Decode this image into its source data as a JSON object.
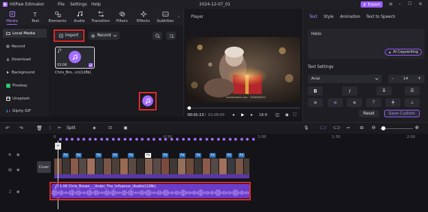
{
  "app": {
    "name": "HitPaw Edimakor",
    "title": "2024-12-07_01",
    "export_label": "Export"
  },
  "menu": [
    "File",
    "Settings",
    "Help"
  ],
  "tabs": [
    {
      "label": "Media",
      "icon": "media-icon"
    },
    {
      "label": "Text",
      "icon": "text-icon"
    },
    {
      "label": "Elements",
      "icon": "elements-icon"
    },
    {
      "label": "Audio",
      "icon": "audio-icon"
    },
    {
      "label": "Transition",
      "icon": "transition-icon"
    },
    {
      "label": "Filters",
      "icon": "filters-icon"
    },
    {
      "label": "Effects",
      "icon": "effects-icon"
    },
    {
      "label": "Subtitles",
      "icon": "subtitles-icon"
    }
  ],
  "leftnav": [
    {
      "label": "Local Media",
      "icon": "folder-icon"
    },
    {
      "label": "Record",
      "icon": "record-icon"
    },
    {
      "label": "Download",
      "icon": "download-icon"
    },
    {
      "label": "Background",
      "icon": "background-icon"
    },
    {
      "label": "Pixabay",
      "icon": "pixabay-icon"
    },
    {
      "label": "Unsplash",
      "icon": "unsplash-icon"
    },
    {
      "label": "Giphy GIF",
      "icon": "giphy-icon"
    }
  ],
  "media": {
    "import_label": "Import",
    "record_label": "Record",
    "item": {
      "duration": "03:06",
      "name": "Chris_Bro...ic)(128k)"
    }
  },
  "player": {
    "title": "Player",
    "watermark": "shutterstock.com · 1558208510",
    "time_current": "00:01:13",
    "time_total": "01:09:00",
    "aspect": "16:9"
  },
  "right": {
    "tabs": [
      "Text",
      "Style",
      "Animation",
      "Text to Speech"
    ],
    "text_value": "Hello",
    "ai_label": "AI Copywriting",
    "settings_title": "Text Settings",
    "font": "Arial",
    "font_size": "14",
    "reset_label": "Reset",
    "save_label": "Save Custom"
  },
  "toolbar": {
    "split_label": "Split"
  },
  "timeline": {
    "ticks": [
      "0",
      "0:30",
      "1:00",
      "1:30",
      "2:00"
    ],
    "cover_label": "Cover",
    "audio_label": "1:06 Chris_Brown_-_Under_The_Influence_(Audio)(128k)"
  },
  "colors": {
    "accent": "#a46cff",
    "highlight": "#e02a2a",
    "audio_track": "#6a3cc9"
  }
}
